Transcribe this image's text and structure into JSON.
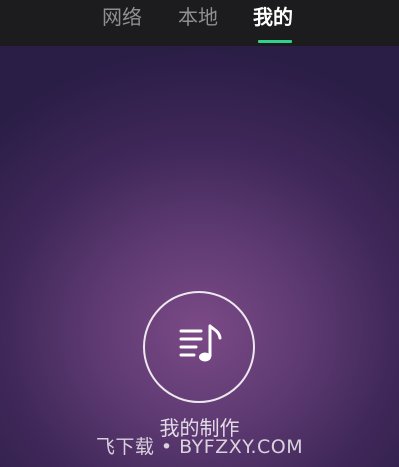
{
  "tabs": [
    {
      "label": "网络",
      "selected": false
    },
    {
      "label": "本地",
      "selected": false
    },
    {
      "label": "我的",
      "selected": true
    }
  ],
  "accent_color": "#2fd38e",
  "main": {
    "icon": "playlist-music-icon",
    "label": "我的制作"
  },
  "watermark": "飞下载 • BYFZXY.COM"
}
